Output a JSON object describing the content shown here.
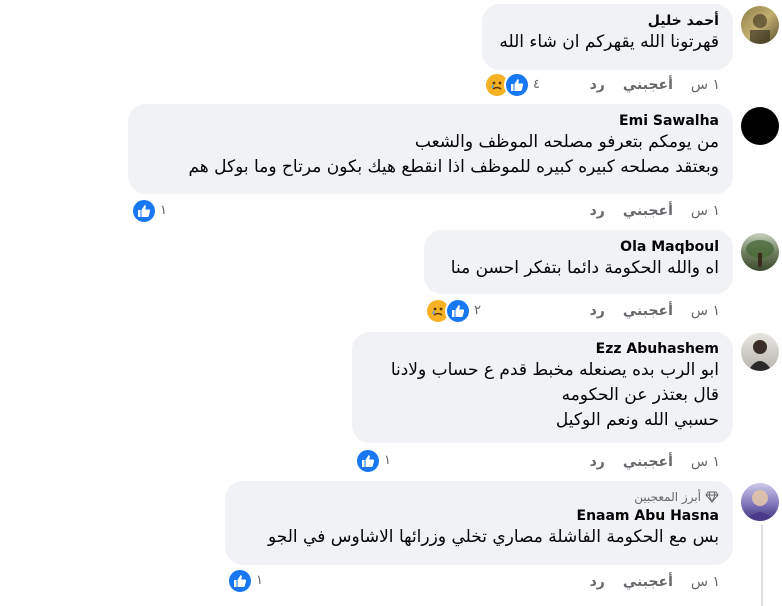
{
  "comments": [
    {
      "author": "أحمد خليل",
      "lines": [
        "قهرتونا الله يقهركم ان شاء الله"
      ],
      "time": "١ س",
      "like_label": "أعجبني",
      "reply_label": "رد",
      "reaction_count": "٤",
      "reactions": [
        "like",
        "sad"
      ]
    },
    {
      "author": "Emi Sawalha",
      "lines": [
        "من يومكم بتعرفو مصلحه الموظف والشعب",
        "وبعتقد مصلحه كبيره كبيره للموظف اذا انقطع هيك بكون مرتاح وما بوكل هم"
      ],
      "time": "١ س",
      "like_label": "أعجبني",
      "reply_label": "رد",
      "reaction_count": "١",
      "reactions": [
        "like"
      ]
    },
    {
      "author": "Ola Maqboul",
      "lines": [
        "اه والله الحكومة دائما بتفكر احسن منا"
      ],
      "time": "١ س",
      "like_label": "أعجبني",
      "reply_label": "رد",
      "reaction_count": "٢",
      "reactions": [
        "like",
        "sad"
      ]
    },
    {
      "author": "Ezz Abuhashem",
      "lines": [
        "ابو الرب بده يصنعله مخبط قدم ع حساب ولادنا",
        "قال بعتذر عن الحكومه",
        "حسبي الله ونعم الوكيل"
      ],
      "time": "١ س",
      "like_label": "أعجبني",
      "reply_label": "رد",
      "reaction_count": "١",
      "reactions": [
        "like"
      ]
    },
    {
      "author": "Enaam Abu Hasna",
      "badge": "أبرز المعجبين",
      "lines": [
        "بس مع الحكومة الفاشلة مصاري تخلي وزرائها الاشاوس في الجو"
      ],
      "time": "١ س",
      "like_label": "أعجبني",
      "reply_label": "رد",
      "reaction_count": "١",
      "reactions": [
        "like"
      ]
    }
  ],
  "colors": {
    "bubble": "#f0f2f5",
    "like": "#1877f2",
    "sad": "#f7b125",
    "meta": "#65676b"
  }
}
